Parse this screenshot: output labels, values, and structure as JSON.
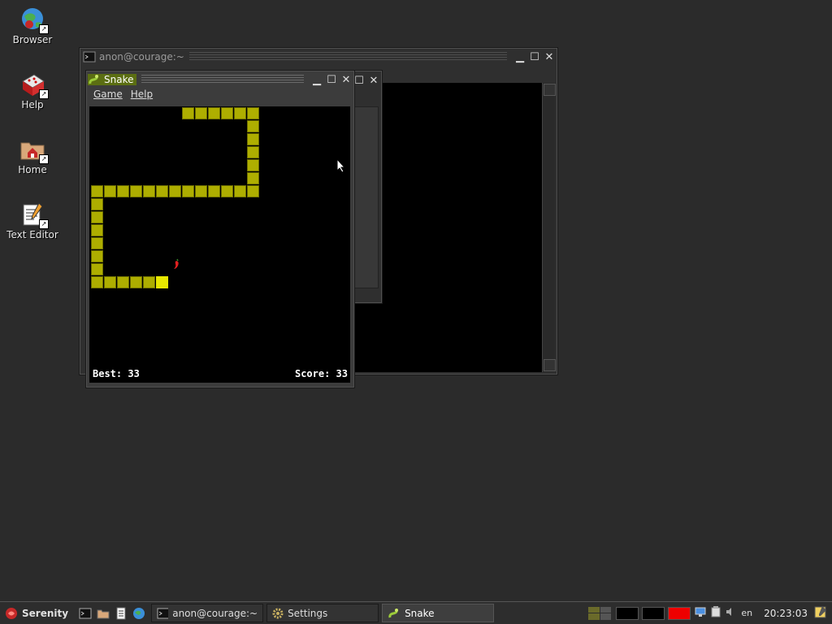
{
  "desktop": {
    "icons": [
      {
        "label": "Browser",
        "icon": "browser-icon"
      },
      {
        "label": "Help",
        "icon": "help-icon"
      },
      {
        "label": "Home",
        "icon": "home-folder-icon"
      },
      {
        "label": "Text Editor",
        "icon": "text-editor-icon"
      }
    ]
  },
  "terminal": {
    "title": "anon@courage:~"
  },
  "snake": {
    "title": "Snake",
    "menu": [
      "Game",
      "Help"
    ],
    "best_label": "Best: 33",
    "score_label": "Score: 33"
  },
  "taskbar": {
    "start_label": "Serenity",
    "tasks": [
      "anon@courage:~",
      "Settings",
      "Snake"
    ],
    "keyboard_layout": "en",
    "clock": "20:23:03"
  },
  "colors": {
    "snake_body": "#aeae00",
    "snake_head": "#e8e800",
    "active_title": "#5b6e12"
  }
}
